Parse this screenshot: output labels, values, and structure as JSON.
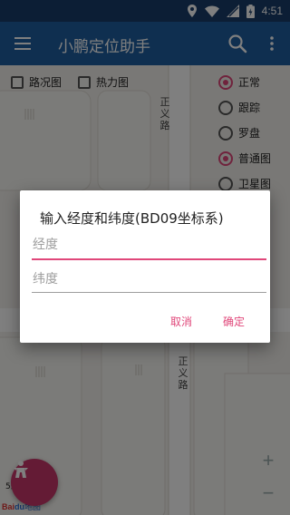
{
  "status_bar": {
    "time": "4:51",
    "icons": [
      "location-icon",
      "wifi-icon",
      "signal-icon",
      "battery-charging-icon"
    ]
  },
  "app_bar": {
    "title": "小鹏定位助手",
    "icons": [
      "menu-icon",
      "search-icon",
      "more-vert-icon"
    ]
  },
  "map": {
    "road_labels": [
      "正义路",
      "正义路"
    ],
    "checkboxes": [
      {
        "label": "路况图",
        "checked": false
      },
      {
        "label": "热力图",
        "checked": false
      }
    ],
    "radios": [
      {
        "label": "正常",
        "selected": true
      },
      {
        "label": "跟踪",
        "selected": false
      },
      {
        "label": "罗盘",
        "selected": false
      },
      {
        "label": "普通图",
        "selected": true
      },
      {
        "label": "卫星图",
        "selected": false
      }
    ],
    "zoom": {
      "in": "+",
      "out": "−"
    },
    "scale_text": "5米",
    "logo": {
      "part1": "Bai",
      "part2": "du",
      "suffix": "地图"
    }
  },
  "dialog": {
    "title": "输入经度和纬度(BD09坐标系)",
    "longitude_placeholder": "经度",
    "latitude_placeholder": "纬度",
    "cancel_label": "取消",
    "confirm_label": "确定"
  },
  "colors": {
    "primary": "#1f5fa0",
    "status_bar": "#183d6a",
    "accent": "#e0477a",
    "fab": "#c8376a"
  }
}
